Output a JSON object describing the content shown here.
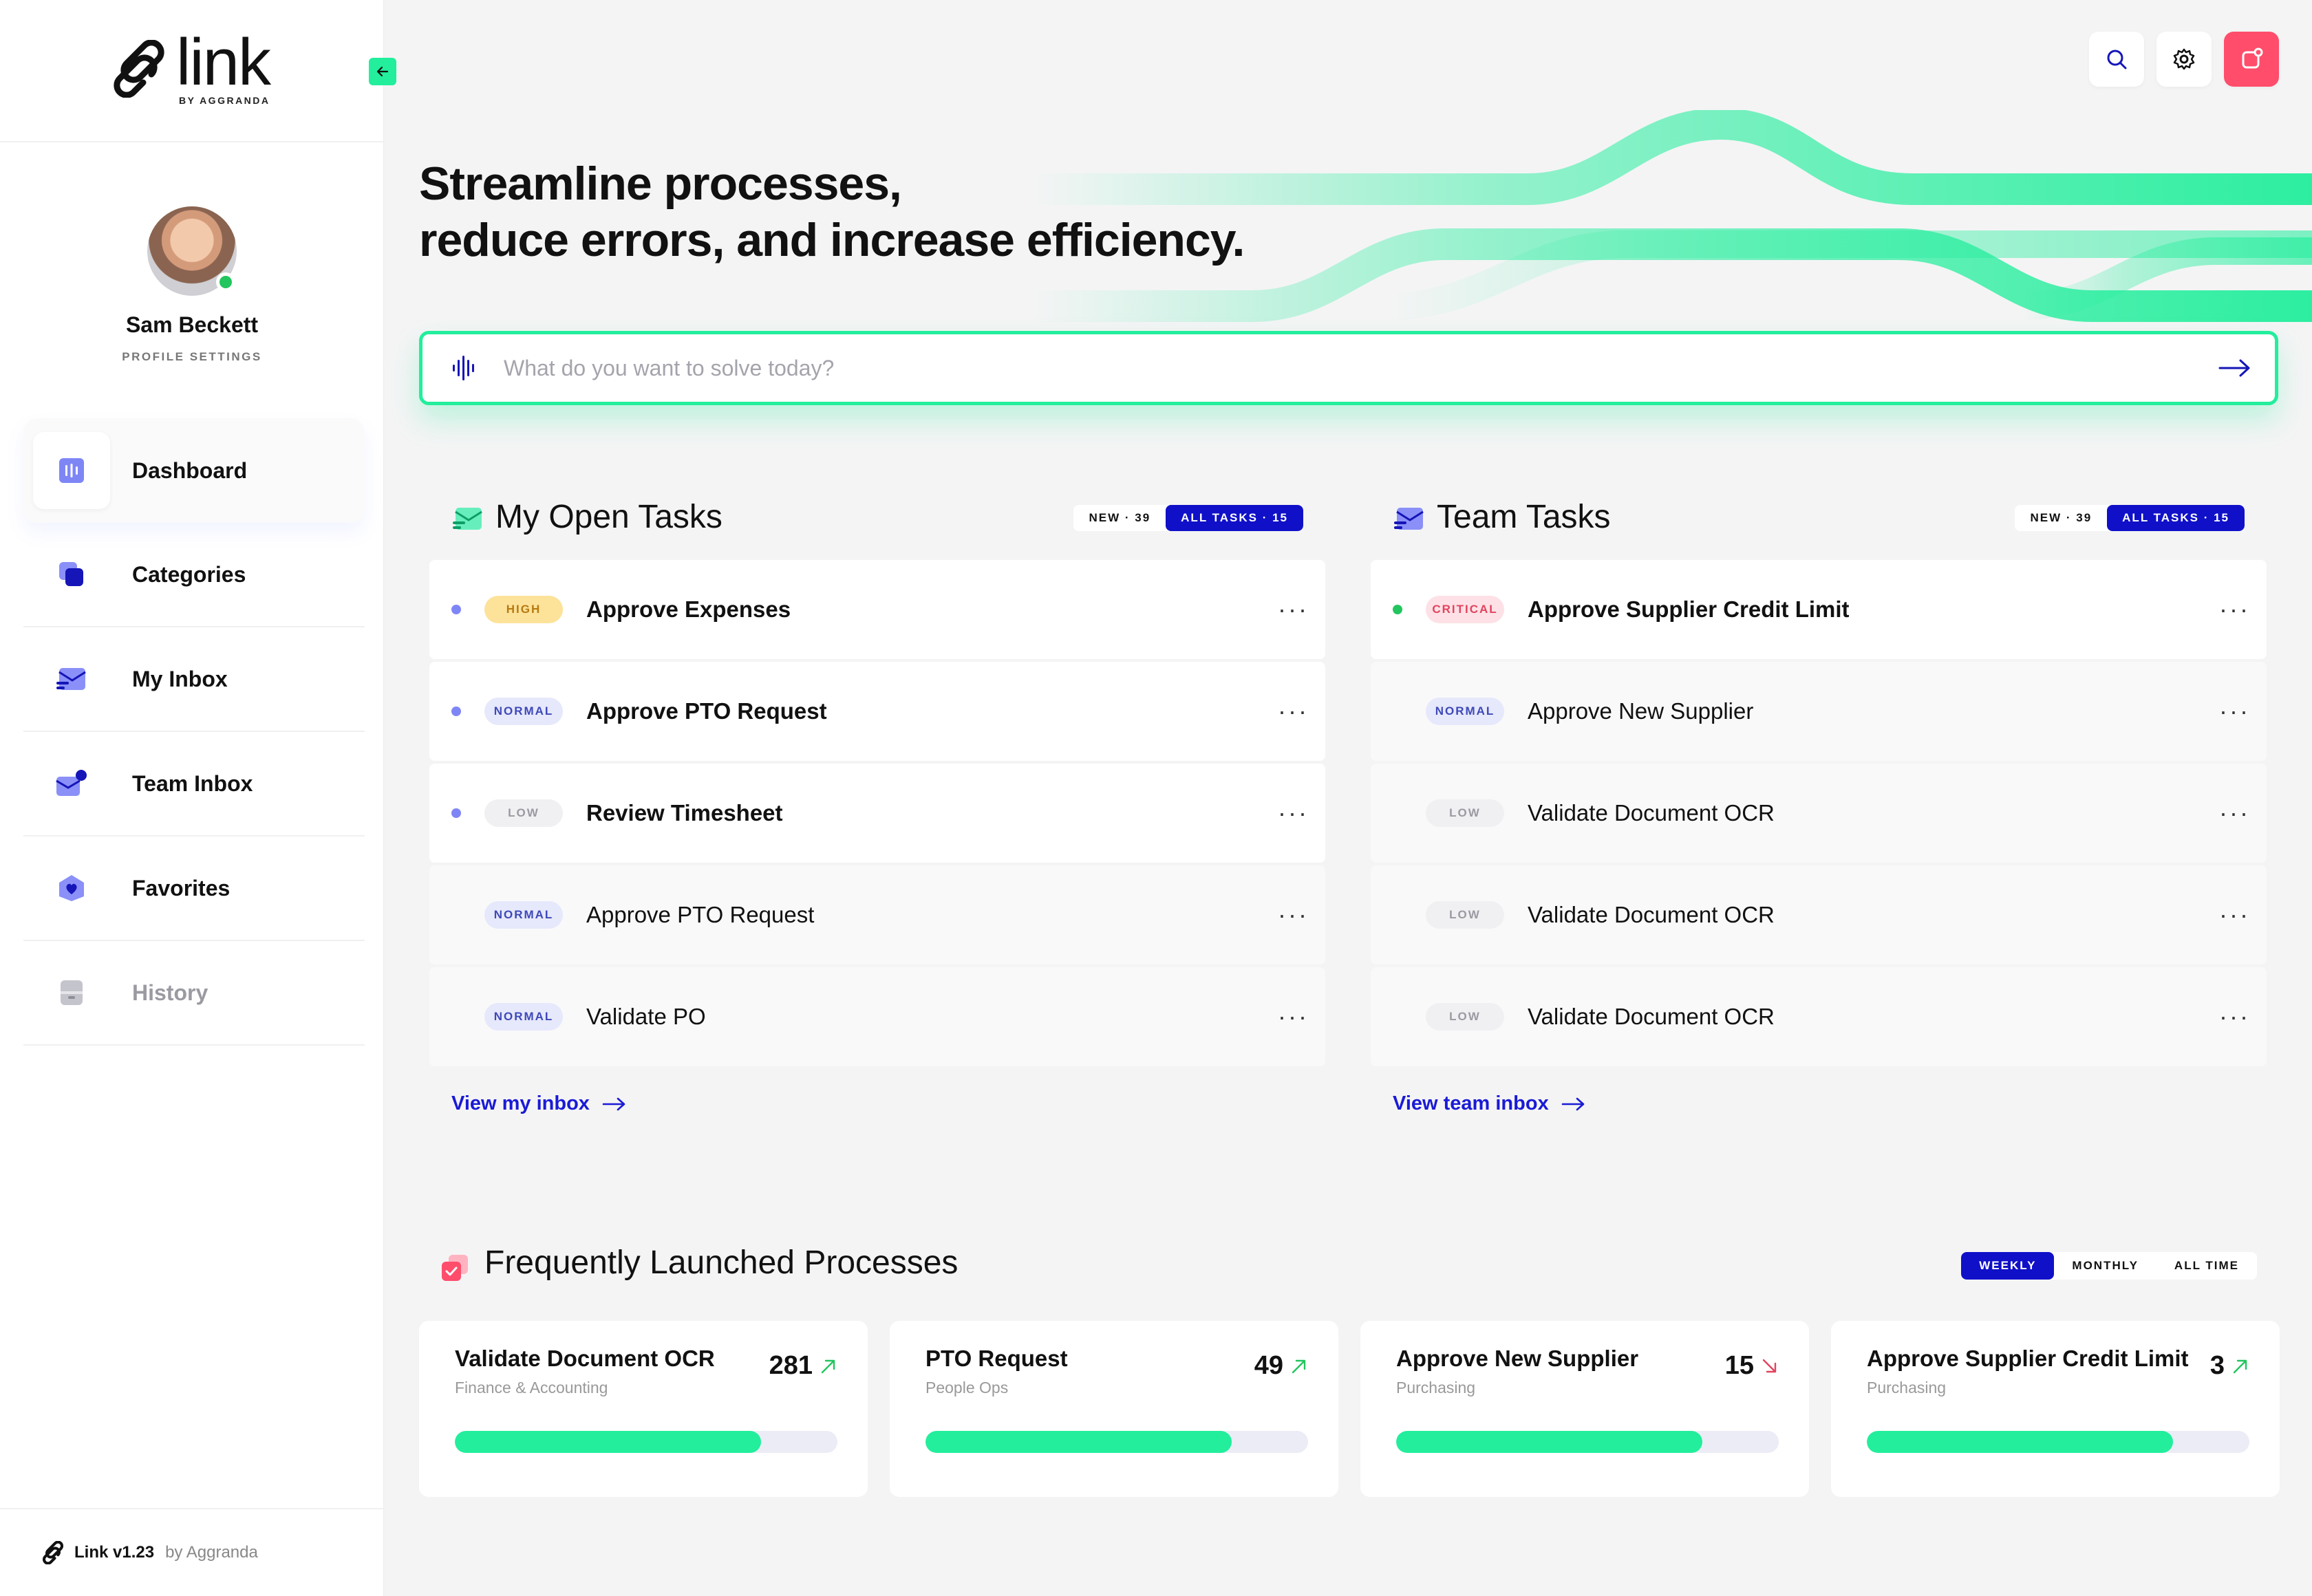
{
  "brand": {
    "word": "link",
    "sub": "BY AGGRANDA"
  },
  "profile": {
    "name": "Sam Beckett",
    "settings": "PROFILE SETTINGS"
  },
  "nav": [
    {
      "label": "Dashboard",
      "icon": "dashboard-icon"
    },
    {
      "label": "Categories",
      "icon": "categories-icon"
    },
    {
      "label": "My Inbox",
      "icon": "inbox-icon"
    },
    {
      "label": "Team Inbox",
      "icon": "team-inbox-icon"
    },
    {
      "label": "Favorites",
      "icon": "favorites-icon"
    },
    {
      "label": "History",
      "icon": "history-icon"
    }
  ],
  "footer": {
    "version": "Link v1.23",
    "by": "by Aggranda"
  },
  "hero": {
    "line1": "Streamline processes,",
    "line2": "reduce errors, and increase efficiency."
  },
  "search": {
    "placeholder": "What do you want to solve today?"
  },
  "my_tasks": {
    "title": "My Open Tasks",
    "seg_new": "NEW · 39",
    "seg_all": "ALL TASKS · 15",
    "items": [
      {
        "priority": "HIGH",
        "name": "Approve Expenses"
      },
      {
        "priority": "NORMAL",
        "name": "Approve PTO Request"
      },
      {
        "priority": "LOW",
        "name": "Review Timesheet"
      },
      {
        "priority": "NORMAL",
        "name": "Approve PTO Request"
      },
      {
        "priority": "NORMAL",
        "name": "Validate PO"
      }
    ],
    "link": "View my inbox"
  },
  "team_tasks": {
    "title": "Team Tasks",
    "seg_new": "NEW · 39",
    "seg_all": "ALL TASKS · 15",
    "items": [
      {
        "priority": "CRITICAL",
        "name": "Approve Supplier Credit Limit"
      },
      {
        "priority": "NORMAL",
        "name": "Approve New Supplier"
      },
      {
        "priority": "LOW",
        "name": "Validate Document OCR"
      },
      {
        "priority": "LOW",
        "name": "Validate Document OCR"
      },
      {
        "priority": "LOW",
        "name": "Validate Document OCR"
      }
    ],
    "link": "View team inbox"
  },
  "processes": {
    "title": "Frequently Launched Processes",
    "periods": [
      "WEEKLY",
      "MONTHLY",
      "ALL TIME"
    ],
    "cards": [
      {
        "title": "Validate Document OCR",
        "sub": "Finance & Accounting",
        "count": "281",
        "trend": "up",
        "progress": 0.8
      },
      {
        "title": "PTO Request",
        "sub": "People Ops",
        "count": "49",
        "trend": "up",
        "progress": 0.8
      },
      {
        "title": "Approve New Supplier",
        "sub": "Purchasing",
        "count": "15",
        "trend": "down",
        "progress": 0.8
      },
      {
        "title": "Approve Supplier Credit Limit",
        "sub": "Purchasing",
        "count": "3",
        "trend": "up",
        "progress": 0.8
      }
    ]
  },
  "colors": {
    "accent_green": "#22ee9c",
    "accent_blue": "#1010c8",
    "accent_red": "#ff4d6b",
    "trend_up": "#22c55e",
    "trend_down": "#e2435e"
  }
}
